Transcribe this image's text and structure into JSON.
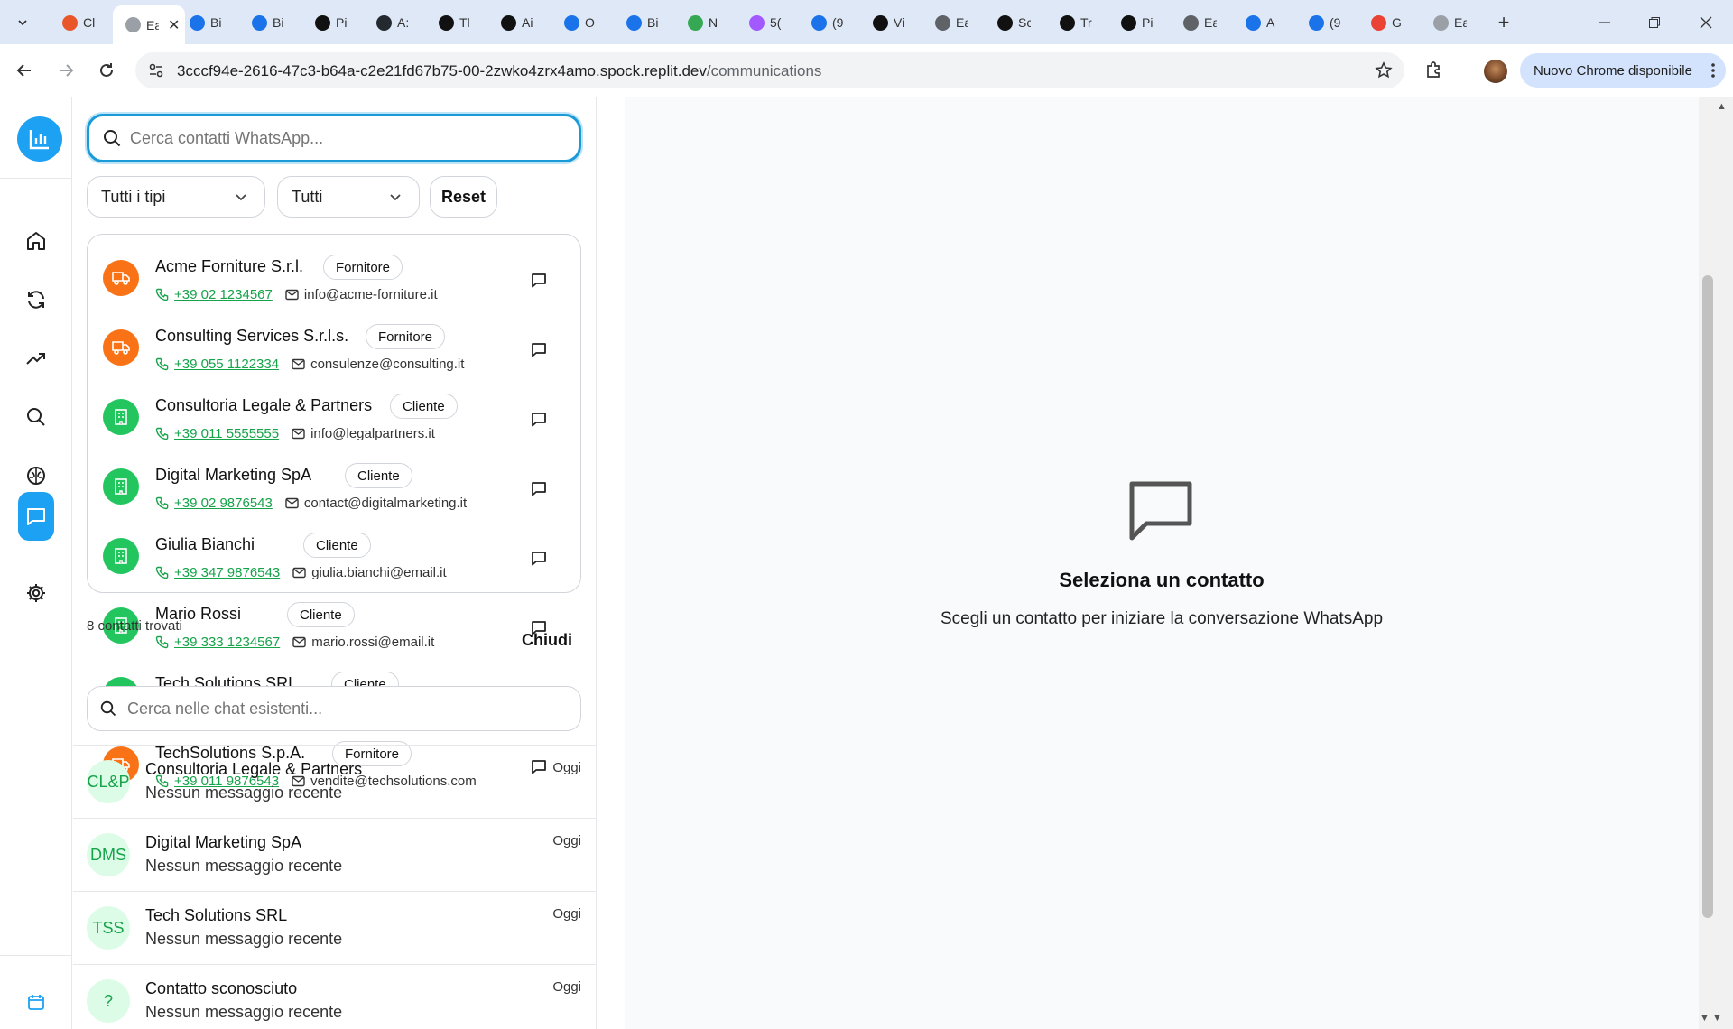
{
  "browser": {
    "tabs": [
      {
        "title": "Cl",
        "color": "#e8562a"
      },
      {
        "title": "Ea",
        "color": "#9aa0a6",
        "active": true
      },
      {
        "title": "Bi",
        "color": "#1a73e8"
      },
      {
        "title": "Bi",
        "color": "#1a73e8"
      },
      {
        "title": "Pi",
        "color": "#111111"
      },
      {
        "title": "A:",
        "color": "#24292f"
      },
      {
        "title": "Tl",
        "color": "#111111"
      },
      {
        "title": "Ai",
        "color": "#111111"
      },
      {
        "title": "O",
        "color": "#1a73e8"
      },
      {
        "title": "Bi",
        "color": "#1a73e8"
      },
      {
        "title": "N",
        "color": "#34a853"
      },
      {
        "title": "5(",
        "color": "#a259ff"
      },
      {
        "title": "(9",
        "color": "#1a73e8"
      },
      {
        "title": "Vi",
        "color": "#111111"
      },
      {
        "title": "Ea",
        "color": "#5f6368"
      },
      {
        "title": "Sc",
        "color": "#111111"
      },
      {
        "title": "Tr",
        "color": "#111111"
      },
      {
        "title": "Pi",
        "color": "#111111"
      },
      {
        "title": "Ea",
        "color": "#5f6368"
      },
      {
        "title": "A",
        "color": "#1a73e8"
      },
      {
        "title": "(9",
        "color": "#1a73e8"
      },
      {
        "title": "G",
        "color": "#ea4335"
      },
      {
        "title": "Ea",
        "color": "#9aa0a6"
      }
    ],
    "url_host": "3cccf94e-2616-47c3-b64a-c2e21fd67b75-00-2zwko4zrx4amo.spock.replit.dev",
    "url_path": "/communications",
    "update_label": "Nuovo Chrome disponibile"
  },
  "search": {
    "contacts_placeholder": "Cerca contatti WhatsApp...",
    "chats_placeholder": "Cerca nelle chat esistenti..."
  },
  "filters": {
    "type_selected": "Tutti i tipi",
    "status_selected": "Tutti",
    "reset_label": "Reset"
  },
  "contacts": [
    {
      "name": "Acme Forniture S.r.l.",
      "badge": "Fornitore",
      "phone": "+39 02 1234567",
      "email": "info@acme-forniture.it",
      "kind": "supplier"
    },
    {
      "name": "Consulting Services S.r.l.s.",
      "badge": "Fornitore",
      "phone": "+39 055 1122334",
      "email": "consulenze@consulting.it",
      "kind": "supplier"
    },
    {
      "name": "Consultoria Legale & Partners",
      "badge": "Cliente",
      "phone": "+39 011 5555555",
      "email": "info@legalpartners.it",
      "kind": "client"
    },
    {
      "name": "Digital Marketing SpA",
      "badge": "Cliente",
      "phone": "+39 02 9876543",
      "email": "contact@digitalmarketing.it",
      "kind": "client"
    },
    {
      "name": "Giulia Bianchi",
      "badge": "Cliente",
      "phone": "+39 347 9876543",
      "email": "giulia.bianchi@email.it",
      "kind": "client"
    },
    {
      "name": "Mario Rossi",
      "badge": "Cliente",
      "phone": "+39 333 1234567",
      "email": "mario.rossi@email.it",
      "kind": "client"
    },
    {
      "name": "Tech Solutions SRL",
      "badge": "Cliente",
      "phone": "",
      "email": "",
      "kind": "client"
    },
    {
      "name": "TechSolutions S.p.A.",
      "badge": "Fornitore",
      "phone": "+39 011 9876543",
      "email": "vendite@techsolutions.com",
      "kind": "supplier"
    }
  ],
  "found_text": "8 contatti trovati",
  "close_label": "Chiudi",
  "chats": [
    {
      "initials": "CL&P",
      "name": "Consultoria Legale & Partners",
      "last": "Nessun messaggio recente",
      "time": "Oggi"
    },
    {
      "initials": "DMS",
      "name": "Digital Marketing SpA",
      "last": "Nessun messaggio recente",
      "time": "Oggi"
    },
    {
      "initials": "TSS",
      "name": "Tech Solutions SRL",
      "last": "Nessun messaggio recente",
      "time": "Oggi"
    },
    {
      "initials": "?",
      "name": "Contatto sconosciuto",
      "last": "Nessun messaggio recente",
      "time": "Oggi"
    }
  ],
  "empty_state": {
    "title": "Seleziona un contatto",
    "subtitle": "Scegli un contatto per iniziare la conversazione WhatsApp"
  },
  "colors": {
    "accent": "#1da1f2",
    "supplier": "#f97316",
    "client": "#22c55e",
    "phone": "#16a34a"
  }
}
